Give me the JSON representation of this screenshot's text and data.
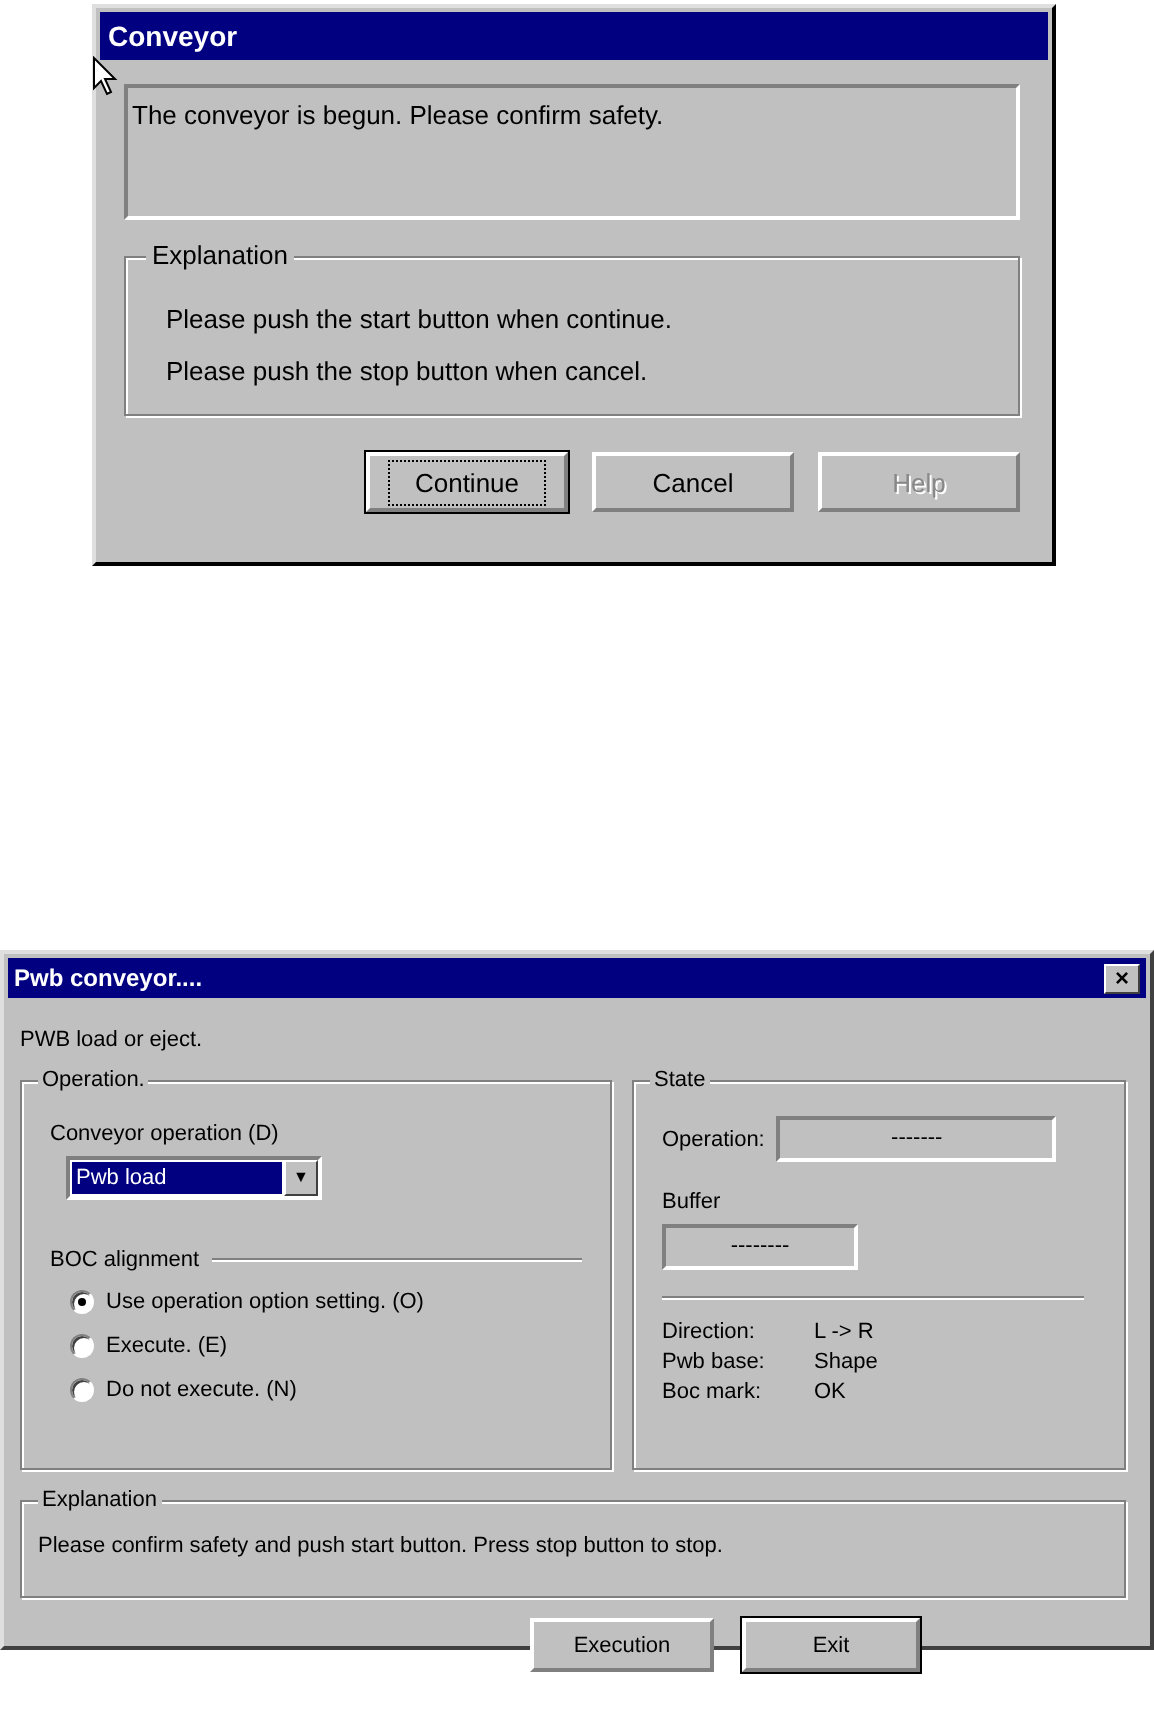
{
  "confirm_dialog": {
    "title": "Conveyor",
    "message": "The conveyor is begun. Please confirm safety.",
    "explanation": {
      "title": "Explanation",
      "lines": [
        "Please push the start button when continue.",
        "Please push the stop button when cancel."
      ]
    },
    "buttons": [
      {
        "label": "Continue",
        "default": true,
        "disabled": false
      },
      {
        "label": "Cancel",
        "default": false,
        "disabled": false
      },
      {
        "label": "Help",
        "default": false,
        "disabled": true
      }
    ]
  },
  "pwb_dialog": {
    "title": "Pwb conveyor....",
    "close": "×",
    "subtitle": "PWB load or eject.",
    "operation": {
      "title": "Operation.",
      "combo_label": "Conveyor operation (D)",
      "combo_value": "Pwb load",
      "combo_arrow": "▼",
      "alignment_title": "BOC alignment",
      "options": [
        {
          "label": "Use operation option setting. (O)",
          "selected": true
        },
        {
          "label": "Execute. (E)",
          "selected": false
        },
        {
          "label": "Do not execute. (N)",
          "selected": false
        }
      ]
    },
    "state": {
      "title": "State",
      "operation_label": "Operation:",
      "operation_value": "-------",
      "buffer_label": "Buffer",
      "buffer_value": "--------",
      "rows": [
        {
          "label": "Direction:",
          "value": "L -> R"
        },
        {
          "label": "Pwb base:",
          "value": "Shape"
        },
        {
          "label": "Boc mark:",
          "value": "OK"
        }
      ]
    },
    "explanation": {
      "title": "Explanation",
      "text": "Please confirm safety and push start button. Press stop button to stop."
    },
    "buttons": [
      {
        "label": "Execution",
        "default": false
      },
      {
        "label": "Exit",
        "default": true
      }
    ]
  }
}
